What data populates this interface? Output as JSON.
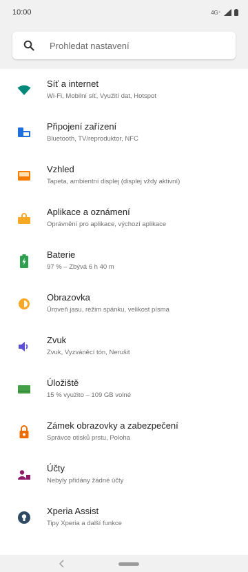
{
  "status_bar": {
    "time": "10:00",
    "network": "4G⁺"
  },
  "search": {
    "placeholder": "Prohledat nastavení"
  },
  "settings": [
    {
      "title": "Síť a internet",
      "subtitle": "Wi-Fi, Mobilní síť, Využití dat, Hotspot",
      "icon": "wifi-icon",
      "color": "#00897b"
    },
    {
      "title": "Připojení zařízení",
      "subtitle": "Bluetooth, TV/reproduktor, NFC",
      "icon": "devices-icon",
      "color": "#1e6fd9"
    },
    {
      "title": "Vzhled",
      "subtitle": "Tapeta, ambientní displej (displej vždy aktivní)",
      "icon": "wallpaper-icon",
      "color": "#f57c00"
    },
    {
      "title": "Aplikace a oznámení",
      "subtitle": "Oprávnění pro aplikace, výchozí aplikace",
      "icon": "apps-icon",
      "color": "#f9a825"
    },
    {
      "title": "Baterie",
      "subtitle": "97 % – Zbývá 6 h  40 m",
      "icon": "battery-icon",
      "color": "#2e9e4f"
    },
    {
      "title": "Obrazovka",
      "subtitle": "Úroveň jasu, režim spánku, velikost písma",
      "icon": "brightness-icon",
      "color": "#f9a825"
    },
    {
      "title": "Zvuk",
      "subtitle": "Zvuk, Vyzváněcí tón, Nerušit",
      "icon": "volume-icon",
      "color": "#5b4fd6"
    },
    {
      "title": "Úložiště",
      "subtitle": "15 % využito – 109 GB volné",
      "icon": "storage-icon",
      "color": "#43a047"
    },
    {
      "title": "Zámek obrazovky a zabezpečení",
      "subtitle": "Správce otisků prstu, Poloha",
      "icon": "lock-icon",
      "color": "#ef6c00"
    },
    {
      "title": "Účty",
      "subtitle": "Nebyly přidány žádné účty",
      "icon": "accounts-icon",
      "color": "#8e1a6a"
    },
    {
      "title": "Xperia Assist",
      "subtitle": "Tipy Xperia a další funkce",
      "icon": "assist-icon",
      "color": "#2f4a63"
    }
  ]
}
